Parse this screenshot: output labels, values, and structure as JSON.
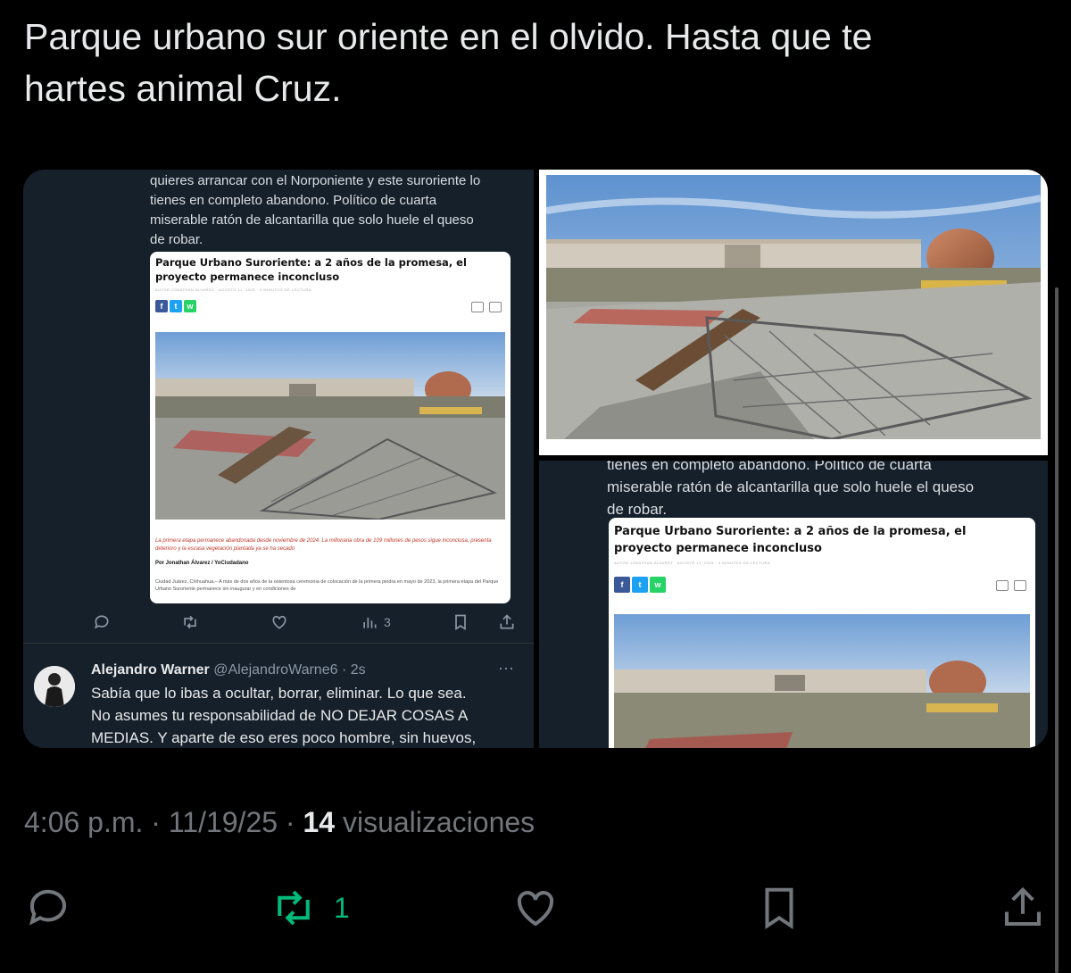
{
  "tweet": {
    "text_line1": "Parque urbano sur oriente en el olvido. Hasta que te",
    "text_line2": "hartes animal Cruz."
  },
  "left_screenshot": {
    "text_line1": "quieres arrancar con el Norponiente y este suroriente lo",
    "text_line2": "tienes en completo abandono. Político de cuarta",
    "text_line3": "miserable ratón de alcantarilla que solo huele el queso",
    "text_line4": "de robar.",
    "article": {
      "title_line1": "Parque Urbano Suroriente: a 2 años de la promesa, el",
      "title_line2": "proyecto permanece inconcluso",
      "meta": "AUTOR JONATHAN ÁLVAREZ   ·   AGOSTO 11, 2025   ·   4 MINUTOS DE LECTURA",
      "caption": "La primera etapa permanece abandonada desde noviembre de 2024. La millonaria obra de 109 millones de pesos sigue inconclusa, presenta deterioro y la escasa vegetación plantada ya se ha secado",
      "byline": "Por Jonathan Álvarez / YoCiudadano",
      "body": "Ciudad Juárez, Chihuahua.– A más de dos años de la ostentosa ceremonia de colocación de la primera piedra en mayo de 2023, la primera etapa del Parque Urbano Suroriente permanece sin inaugurar y en condiciones de"
    },
    "actions": {
      "views": "3"
    },
    "reply": {
      "name": "Alejandro Warner",
      "handle": "@AlejandroWarne6 · 2s",
      "more": "···",
      "body_line1": "Sabía que lo ibas a ocultar, borrar, eliminar. Lo que sea.",
      "body_line2": "No asumes tu responsabilidad de NO DEJAR COSAS A",
      "body_line3": "MEDIAS. Y aparte de eso eres poco hombre, sin huevos,"
    }
  },
  "bottom_right_screenshot": {
    "text_line0": "tienes en completo abandono. Político de cuarta",
    "text_line1": "miserable ratón de alcantarilla que solo huele el queso",
    "text_line2": "de robar.",
    "article": {
      "title_line1": "Parque Urbano Suroriente: a 2 años de la promesa, el",
      "title_line2": "proyecto permanece inconcluso",
      "meta": "AUTOR JONATHAN ÁLVAREZ   ·   AGOSTO 11, 2025   ·   4 MINUTOS DE LECTURA"
    }
  },
  "meta": {
    "time": "4:06 p.m.",
    "sep1": " · ",
    "date": "11/19/25",
    "sep2": " · ",
    "views_count": "14",
    "views_label": " visualizaciones"
  },
  "action_bar": {
    "repost_count": "1"
  },
  "colors": {
    "background": "#000000",
    "dim_text": "#71767b",
    "repost_green": "#00ba7c",
    "embedded_bg": "#15202b"
  }
}
